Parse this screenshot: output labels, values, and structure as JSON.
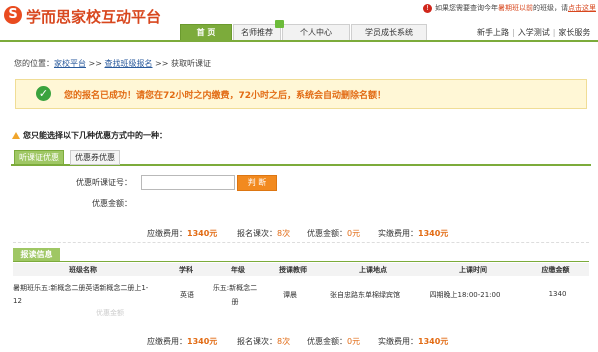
{
  "header": {
    "logo_mark": "S",
    "logo_text": "学而思家校互动平台",
    "notice": {
      "icon": "warning-circle-icon",
      "prefix": "如果您需要查询今年",
      "highlight": "暑期班以前",
      "middle": "的班级，请",
      "link": "点击这里"
    },
    "nav": {
      "tabs": [
        {
          "label": "首 页",
          "active": true
        },
        {
          "label": "名师推荐",
          "active": false
        },
        {
          "label": "个人中心",
          "active": false
        },
        {
          "label": "学员成长系统",
          "active": false
        }
      ]
    },
    "quicklinks": [
      "新手上路",
      "入学测试",
      "家长服务"
    ]
  },
  "breadcrumb": {
    "prefix": "您的位置：",
    "items": [
      "家校平台",
      "查找班级报名",
      "获取听课证"
    ],
    "separator": ">>"
  },
  "success": {
    "icon": "check-circle-icon",
    "message": "您的报名已成功！请您在72小时之内缴费，72小时之后，系统会自动删除名额！"
  },
  "instruction": {
    "icon": "warning-triangle-icon",
    "text": "您只能选择以下几种优惠方式中的一种："
  },
  "coupon_tabs": [
    {
      "label": "听课证优惠",
      "active": true
    },
    {
      "label": "优惠券优惠",
      "active": false
    }
  ],
  "form": {
    "code_label": "优惠听课证号：",
    "code_value": "",
    "check_button": "判 断",
    "discount_label": "优惠金额："
  },
  "summary": {
    "fee_label": "应缴费用：",
    "fee_value": "1340元",
    "lessons_label": "报名课次：",
    "lessons_value": "8次",
    "discount_label": "优惠金额：",
    "discount_value": "0元",
    "paid_label": "实缴费用：",
    "paid_value": "1340元"
  },
  "enrollment": {
    "title": "报读信息",
    "columns": [
      "班级名称",
      "学科",
      "年级",
      "授课教师",
      "上课地点",
      "上课时间",
      "应缴金额"
    ],
    "rows": [
      {
        "class_name_1": "暑期班乐五:新概念二册英语新概念二册上1-",
        "class_name_2": "12",
        "subject": "英语",
        "grade_1": "乐五:新概念二",
        "grade_2": "册",
        "teacher": "谭晨",
        "location": "张自忠路东单棉绿宾馆",
        "time": "四期晚上18:00-21:00",
        "amount": "1340"
      }
    ],
    "ghost_label": "优惠金额"
  }
}
